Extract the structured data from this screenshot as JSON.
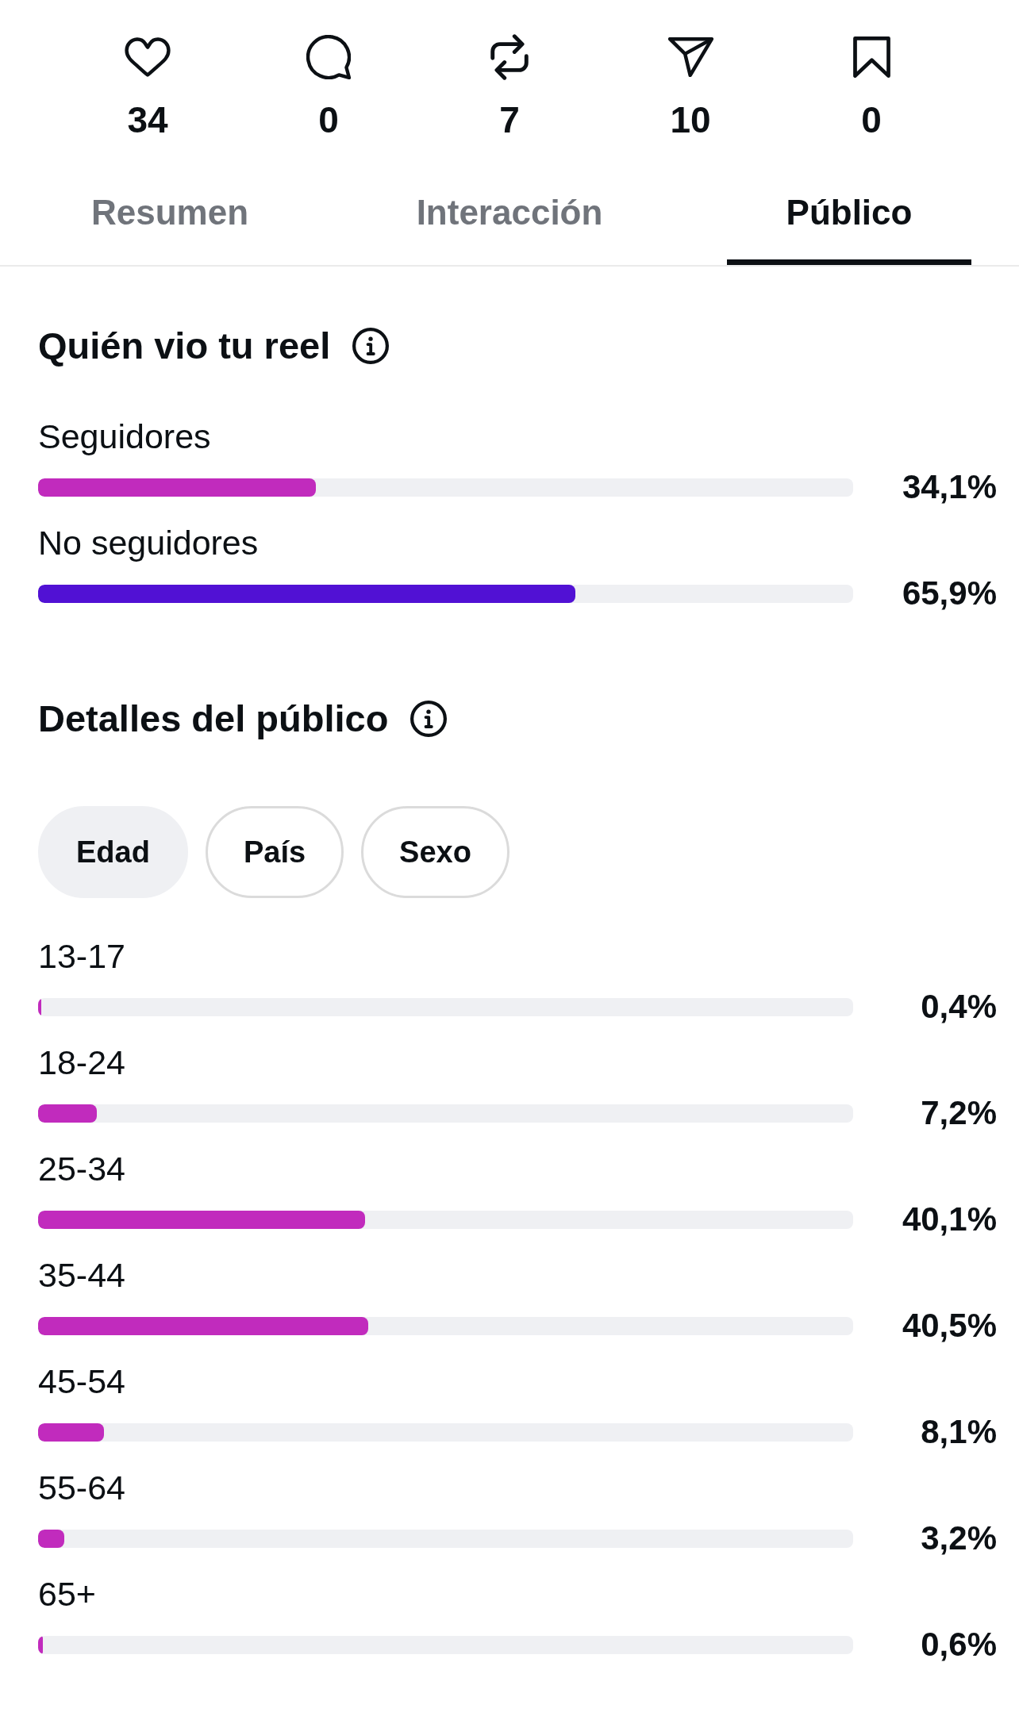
{
  "stats": [
    {
      "count": "34"
    },
    {
      "count": "0"
    },
    {
      "count": "7"
    },
    {
      "count": "10"
    },
    {
      "count": "0"
    }
  ],
  "tabs": [
    {
      "label": "Resumen",
      "selected": false
    },
    {
      "label": "Interacción",
      "selected": false
    },
    {
      "label": "Público",
      "selected": true
    }
  ],
  "viewers": {
    "title": "Quién vio tu reel",
    "items": [
      {
        "label": "Seguidores",
        "level": 0.341,
        "reading": "34,1%",
        "color": "#c12bbd"
      },
      {
        "label": "No seguidores",
        "level": 0.659,
        "reading": "65,9%",
        "color": "#5111d4"
      }
    ]
  },
  "audience_details": {
    "title": "Detalles del público",
    "filters": [
      {
        "label": "Edad",
        "selected": true
      },
      {
        "label": "País",
        "selected": false
      },
      {
        "label": "Sexo",
        "selected": false
      }
    ],
    "age_groups": [
      {
        "label": "13-17",
        "level": 0.004,
        "reading": "0,4%"
      },
      {
        "label": "18-24",
        "level": 0.072,
        "reading": "7,2%"
      },
      {
        "label": "25-34",
        "level": 0.401,
        "reading": "40,1%"
      },
      {
        "label": "35-44",
        "level": 0.405,
        "reading": "40,5%"
      },
      {
        "label": "45-54",
        "level": 0.081,
        "reading": "8,1%"
      },
      {
        "label": "55-64",
        "level": 0.032,
        "reading": "3,2%"
      },
      {
        "label": "65+",
        "level": 0.006,
        "reading": "0,6%"
      }
    ]
  }
}
